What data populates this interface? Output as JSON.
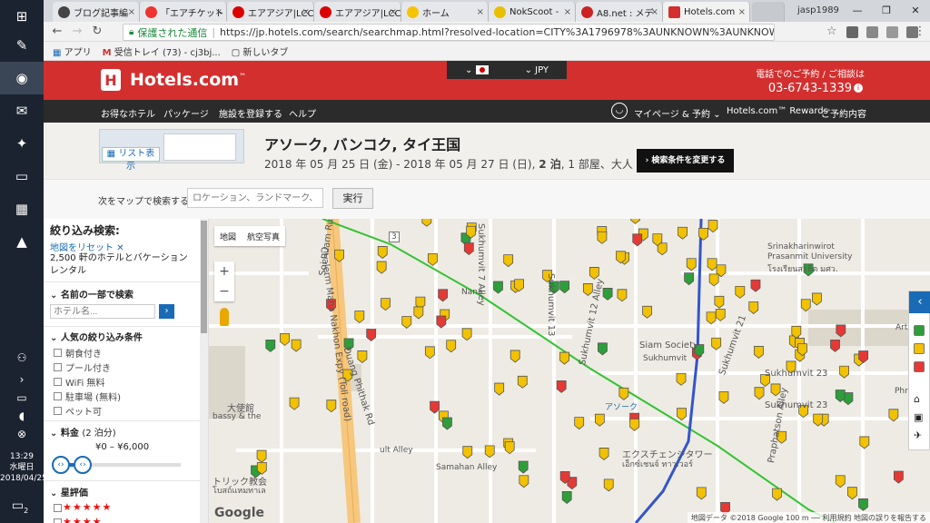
{
  "taskbar": {
    "clock_time": "13:29",
    "clock_day": "水曜日",
    "clock_date": "2018/04/25",
    "notify_count": "2"
  },
  "browser": {
    "tabs": [
      {
        "label": "ブログ記事編",
        "icon_color": "#444"
      },
      {
        "label": "「エアチケット",
        "icon_color": "#e33"
      },
      {
        "label": "エアアジア|LCC",
        "icon_color": "#d00"
      },
      {
        "label": "エアアジア|LCC",
        "icon_color": "#d00"
      },
      {
        "label": "ホーム",
        "icon_color": "#f5c400"
      },
      {
        "label": "NokScoot -",
        "icon_color": "#e8c000"
      },
      {
        "label": "A8.net : メデ",
        "icon_color": "#c22"
      },
      {
        "label": "Hotels.com",
        "icon_color": "#d32f2f"
      }
    ],
    "tab_close": "×",
    "profile": "jasp1989",
    "window_controls": [
      "—",
      "❐",
      "✕"
    ],
    "nav": {
      "back": "←",
      "forward": "→",
      "reload": "↻"
    },
    "secure_label": "保護された通信",
    "url": "https://jp.hotels.com/search/searchmap.html?resolved-location=CITY%3A1796978%3AUNKNOWN%3AUNKNOWN&f-price-currenc...",
    "bookmarks": [
      {
        "icon": "▦",
        "label": "アプリ"
      },
      {
        "icon": "M",
        "label": "受信トレイ (73) - cj3bj..."
      },
      {
        "icon": "▢",
        "label": "新しいタブ"
      }
    ]
  },
  "header": {
    "brand": "Hotels.com",
    "brand_tm": "™",
    "locale_currency": "JPY",
    "phone_label": "電話でのご予約 / ご相談は",
    "phone_number": "03-6743-1339",
    "phone_info": "i",
    "nav_items": [
      "お得なホテル",
      "パッケージ",
      "施設を登録する",
      "ヘルプ"
    ],
    "account_menu": "マイページ & 予約",
    "rewards": "Hotels.com™ Rewards",
    "bookings": "ご予約内容"
  },
  "summary": {
    "list_view": "リスト表示",
    "destination": "アソーク, バンコク, タイ王国",
    "dates": "2018 年 05 月 25 日 (金) - 2018 年 05 月 27 日 (日),",
    "nights": "2 泊",
    "rooms_guests": ", 1 部屋、大人 2 名",
    "change_button": "検索条件を変更する"
  },
  "map_search": {
    "label": "次をマップで検索する",
    "placeholder": "ロケーション、ランドマーク、駅",
    "button": "実行"
  },
  "filters": {
    "title": "絞り込み検索:",
    "reset": "地図をリセット",
    "reset_x": "✕",
    "result_count": "2,500 軒のホテルとバケーション レンタル",
    "name_section": "名前の一部で検索",
    "name_placeholder": "ホテル名...",
    "name_go": "›",
    "popular_section": "人気の絞り込み条件",
    "popular_options": [
      "朝食付き",
      "プール付き",
      "WiFi 無料",
      "駐車場 (無料)",
      "ペット可"
    ],
    "price_section": "料金",
    "price_note": "(2 泊分)",
    "price_range": "¥0 – ¥6,000",
    "star_section": "星評価",
    "star_rows": [
      "★★★★★",
      "★★★★"
    ]
  },
  "map": {
    "type_map": "地図",
    "type_satellite": "航空写真",
    "zoom_in": "+",
    "zoom_out": "−",
    "attribution": "地図データ ©2018 Google  100 m ──  利用規約  地図の誤りを報告する",
    "google": "Google",
    "labels": {
      "nana": "Nana",
      "sukhumvit": "Sukhumvit",
      "asoke": "アソーク",
      "exchange": "エクスチェンジタワー",
      "exchange_th": "เอ็กซ์เชนจ์ ทาวเวอร์",
      "siam": "Siam Society",
      "swu": "Srinakharinwirot",
      "swu2": "Prasanmit University",
      "swu_th": "โรงเรียนสาธิต มศว.",
      "embassy": "大使館",
      "embassy2": "bassy & the",
      "church": "トリック教会",
      "church_th": "โบสถ์แหมทาเล",
      "samahan": "Samahan Alley",
      "phraphatson": "Praphatson Alley",
      "soi_ruam": "Soi Ruam Rudee",
      "chalerm": "Chalerm Maha Nakhon Expy (Toll road)",
      "duang": "Duang Phithak Rd",
      "soi15": "Soi 15",
      "soi23": "Sukhumvit 23",
      "alley23": "Sukhumvit 23",
      "soi7": "Sukhumvit 7 Alley",
      "soi12": "Sukhumvit 12 Alley",
      "soi13": "Sukhumvit 13",
      "soi21": "Sukhumvit 21",
      "phrom": "Phrom",
      "arts": "Arts C",
      "soiro": "Soi",
      "ult": "ult Alley",
      "road3": "3"
    }
  },
  "legend": {
    "toggle": "‹",
    "colors": [
      "#2e9e3a",
      "#f2c200",
      "#e53935"
    ]
  },
  "colors": {
    "brand_red": "#d32f2f",
    "marker_yellow": "#f2c200",
    "marker_red": "#e53935",
    "marker_green": "#2e9e3a",
    "expressway": "#f6c77c",
    "bts_line": "#33c233",
    "mrt_line": "#3355cc"
  }
}
